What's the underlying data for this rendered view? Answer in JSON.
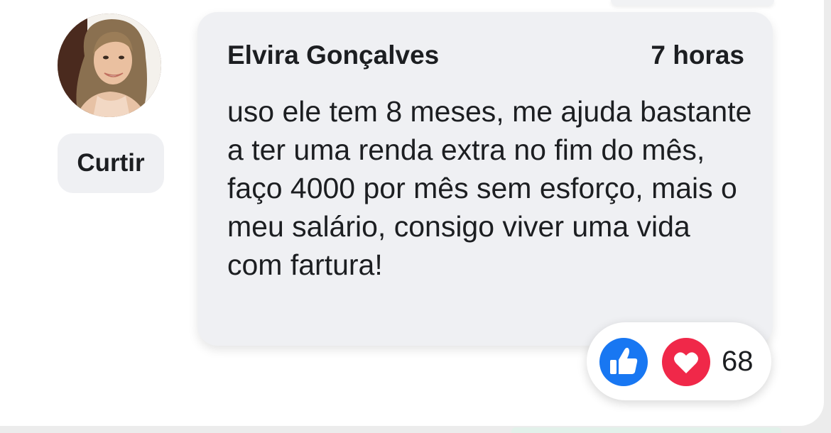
{
  "comment": {
    "author": "Elvira Gonçalves",
    "timestamp": "7 horas",
    "text": "uso ele tem 8 meses, me ajuda bastante a ter uma renda extra no fim do mês, faço 4000 por mês sem esforço, mais o meu salário, consigo viver uma vida com fartura!",
    "avatar_icon": "user-avatar-photo"
  },
  "actions": {
    "like_label": "Curtir"
  },
  "reactions": {
    "icons": [
      "like-icon",
      "love-icon"
    ],
    "count": "68",
    "like_color": "#1877f2",
    "love_color": "#f02849"
  },
  "colors": {
    "bubble_background": "#eff0f3",
    "text": "#1c1e21"
  }
}
